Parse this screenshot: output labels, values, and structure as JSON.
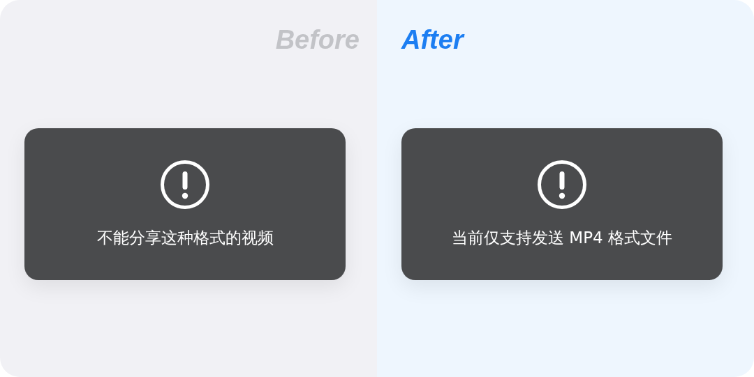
{
  "panels": [
    {
      "kind": "before",
      "heading": "Before",
      "toast": {
        "message": "不能分享这种格式的视频"
      }
    },
    {
      "kind": "after",
      "heading": "After",
      "toast": {
        "message": "当前仅支持发送 MP4 格式文件"
      }
    }
  ]
}
